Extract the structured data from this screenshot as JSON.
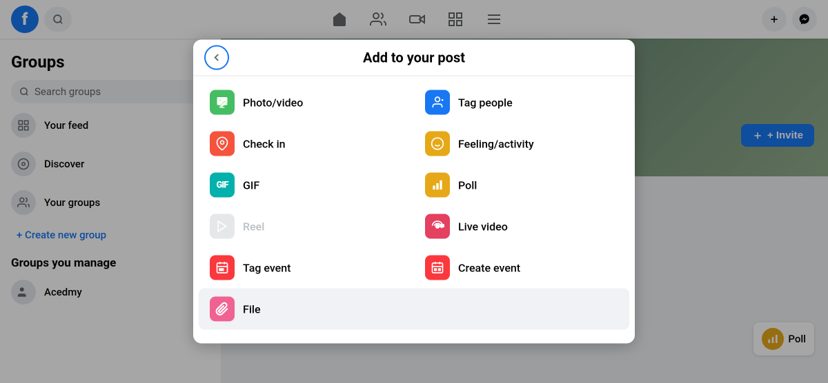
{
  "app": {
    "name": "Facebook",
    "logo": "f"
  },
  "topnav": {
    "search_placeholder": "Search",
    "icons": [
      "🏠",
      "👥",
      "▶",
      "🖥",
      "☰"
    ],
    "right_icons": [
      "+",
      "💬"
    ]
  },
  "sidebar": {
    "title": "Groups",
    "search_placeholder": "Search groups",
    "items": [
      {
        "label": "Your feed",
        "icon": "⊞"
      },
      {
        "label": "Discover",
        "icon": "🔍"
      },
      {
        "label": "Your groups",
        "icon": "👥"
      }
    ],
    "create_group": "+ Create new group",
    "section_manage": "Groups you manage",
    "manage_items": [
      {
        "label": "Acedmy",
        "icon": "👥"
      }
    ]
  },
  "main": {
    "invite_button": "+ Invite",
    "poll_label": "Poll"
  },
  "modal": {
    "title": "Add to your post",
    "back_label": "←",
    "items": [
      {
        "id": "photo-video",
        "label": "Photo/video",
        "icon": "🖼",
        "icon_class": "icon-green",
        "disabled": false
      },
      {
        "id": "tag-people",
        "label": "Tag people",
        "icon": "👤",
        "icon_class": "icon-blue",
        "disabled": false
      },
      {
        "id": "check-in",
        "label": "Check in",
        "icon": "📍",
        "icon_class": "icon-red",
        "disabled": false
      },
      {
        "id": "feeling-activity",
        "label": "Feeling/activity",
        "icon": "😊",
        "icon_class": "icon-yellow",
        "disabled": false
      },
      {
        "id": "gif",
        "label": "GIF",
        "icon": "GIF",
        "icon_class": "icon-teal",
        "disabled": false
      },
      {
        "id": "poll",
        "label": "Poll",
        "icon": "📊",
        "icon_class": "icon-yellow",
        "disabled": false
      },
      {
        "id": "reel",
        "label": "Reel",
        "icon": "▶",
        "icon_class": "icon-gray",
        "disabled": true
      },
      {
        "id": "live-video",
        "label": "Live video",
        "icon": "🔴",
        "icon_class": "icon-pink",
        "disabled": false
      },
      {
        "id": "tag-event",
        "label": "Tag event",
        "icon": "📅",
        "icon_class": "icon-calendar-red",
        "disabled": false
      },
      {
        "id": "create-event",
        "label": "Create event",
        "icon": "📅",
        "icon_class": "icon-calendar-red",
        "disabled": false
      },
      {
        "id": "file",
        "label": "File",
        "icon": "📎",
        "icon_class": "icon-pink-light",
        "disabled": false,
        "full_width": true,
        "highlighted": true
      }
    ]
  }
}
